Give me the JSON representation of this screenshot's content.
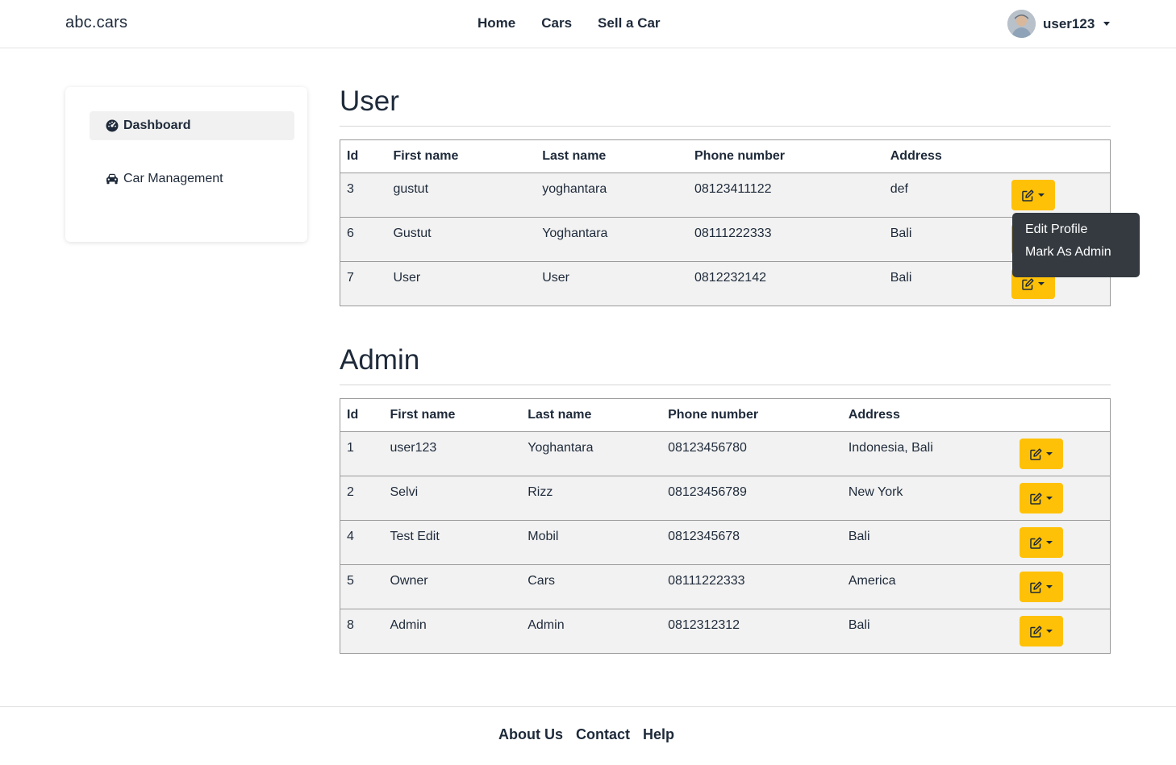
{
  "navbar": {
    "brand": "abc.cars",
    "links": [
      "Home",
      "Cars",
      "Sell a Car"
    ],
    "username": "user123"
  },
  "sidebar": {
    "items": [
      {
        "label": "Dashboard",
        "icon": "dashboard-gauge-icon",
        "active": true
      },
      {
        "label": "Car Management",
        "icon": "car-icon",
        "active": false
      }
    ]
  },
  "user_section": {
    "title": "User",
    "columns": [
      "Id",
      "First name",
      "Last name",
      "Phone number",
      "Address"
    ],
    "rows": [
      {
        "id": "3",
        "first": "gustut",
        "last": "yoghantara",
        "phone": "08123411122",
        "address": "def"
      },
      {
        "id": "6",
        "first": "Gustut",
        "last": "Yoghantara",
        "phone": "08111222333",
        "address": "Bali"
      },
      {
        "id": "7",
        "first": "User",
        "last": "User",
        "phone": "0812232142",
        "address": "Bali"
      }
    ]
  },
  "admin_section": {
    "title": "Admin",
    "columns": [
      "Id",
      "First name",
      "Last name",
      "Phone number",
      "Address"
    ],
    "rows": [
      {
        "id": "1",
        "first": "user123",
        "last": "Yoghantara",
        "phone": "08123456780",
        "address": "Indonesia, Bali"
      },
      {
        "id": "2",
        "first": "Selvi",
        "last": "Rizz",
        "phone": "08123456789",
        "address": "New York"
      },
      {
        "id": "4",
        "first": "Test Edit",
        "last": "Mobil",
        "phone": "0812345678",
        "address": "Bali"
      },
      {
        "id": "5",
        "first": "Owner",
        "last": "Cars",
        "phone": "08111222333",
        "address": "America"
      },
      {
        "id": "8",
        "first": "Admin",
        "last": "Admin",
        "phone": "0812312312",
        "address": "Bali"
      }
    ]
  },
  "row_menu": {
    "items": [
      "Edit Profile",
      "Mark As Admin"
    ]
  },
  "footer": {
    "links": [
      "About Us",
      "Contact",
      "Help"
    ]
  },
  "colors": {
    "accent": "#ffc107",
    "text": "#1e2a3a",
    "menu_bg": "#343a40",
    "row_bg": "#f2f2f2"
  }
}
